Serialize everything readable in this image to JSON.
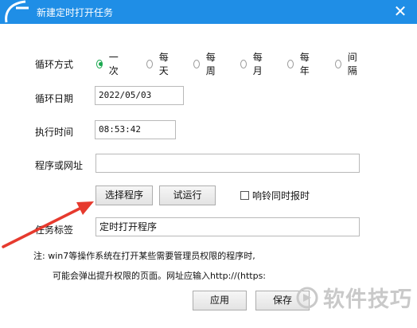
{
  "window": {
    "title": "新建定时打开任务",
    "close_glyph": "✕"
  },
  "labels": {
    "loop_mode": "循环方式",
    "loop_date": "循环日期",
    "exec_time": "执行时间",
    "program_url": "程序或网址",
    "task_label": "任务标签"
  },
  "loop_options": [
    {
      "label": "一次",
      "selected": true
    },
    {
      "label": "每天",
      "selected": false
    },
    {
      "label": "每周",
      "selected": false
    },
    {
      "label": "每月",
      "selected": false
    },
    {
      "label": "每年",
      "selected": false
    },
    {
      "label": "间隔",
      "selected": false
    }
  ],
  "fields": {
    "loop_date_value": "2022/05/03",
    "exec_time_value": "08:53:42",
    "program_url_value": "",
    "task_label_value": "定时打开程序"
  },
  "buttons": {
    "choose_program": "选择程序",
    "test_run": "试运行",
    "apply": "应用",
    "save": "保存"
  },
  "checkbox": {
    "label": "响铃同时报时",
    "checked": false
  },
  "notes": {
    "line1": "注: win7等操作系统在打开某些需要管理员权限的程序时,",
    "line2": "可能会弹出提升权限的页面。网址应输入http://(https:"
  },
  "watermark": {
    "text": "软件技巧"
  },
  "colors": {
    "titlebar": "#1f8ee6",
    "radio_selected": "#1aa84f",
    "arrow": "#e63a2e",
    "watermark": "#c9c9c9"
  }
}
